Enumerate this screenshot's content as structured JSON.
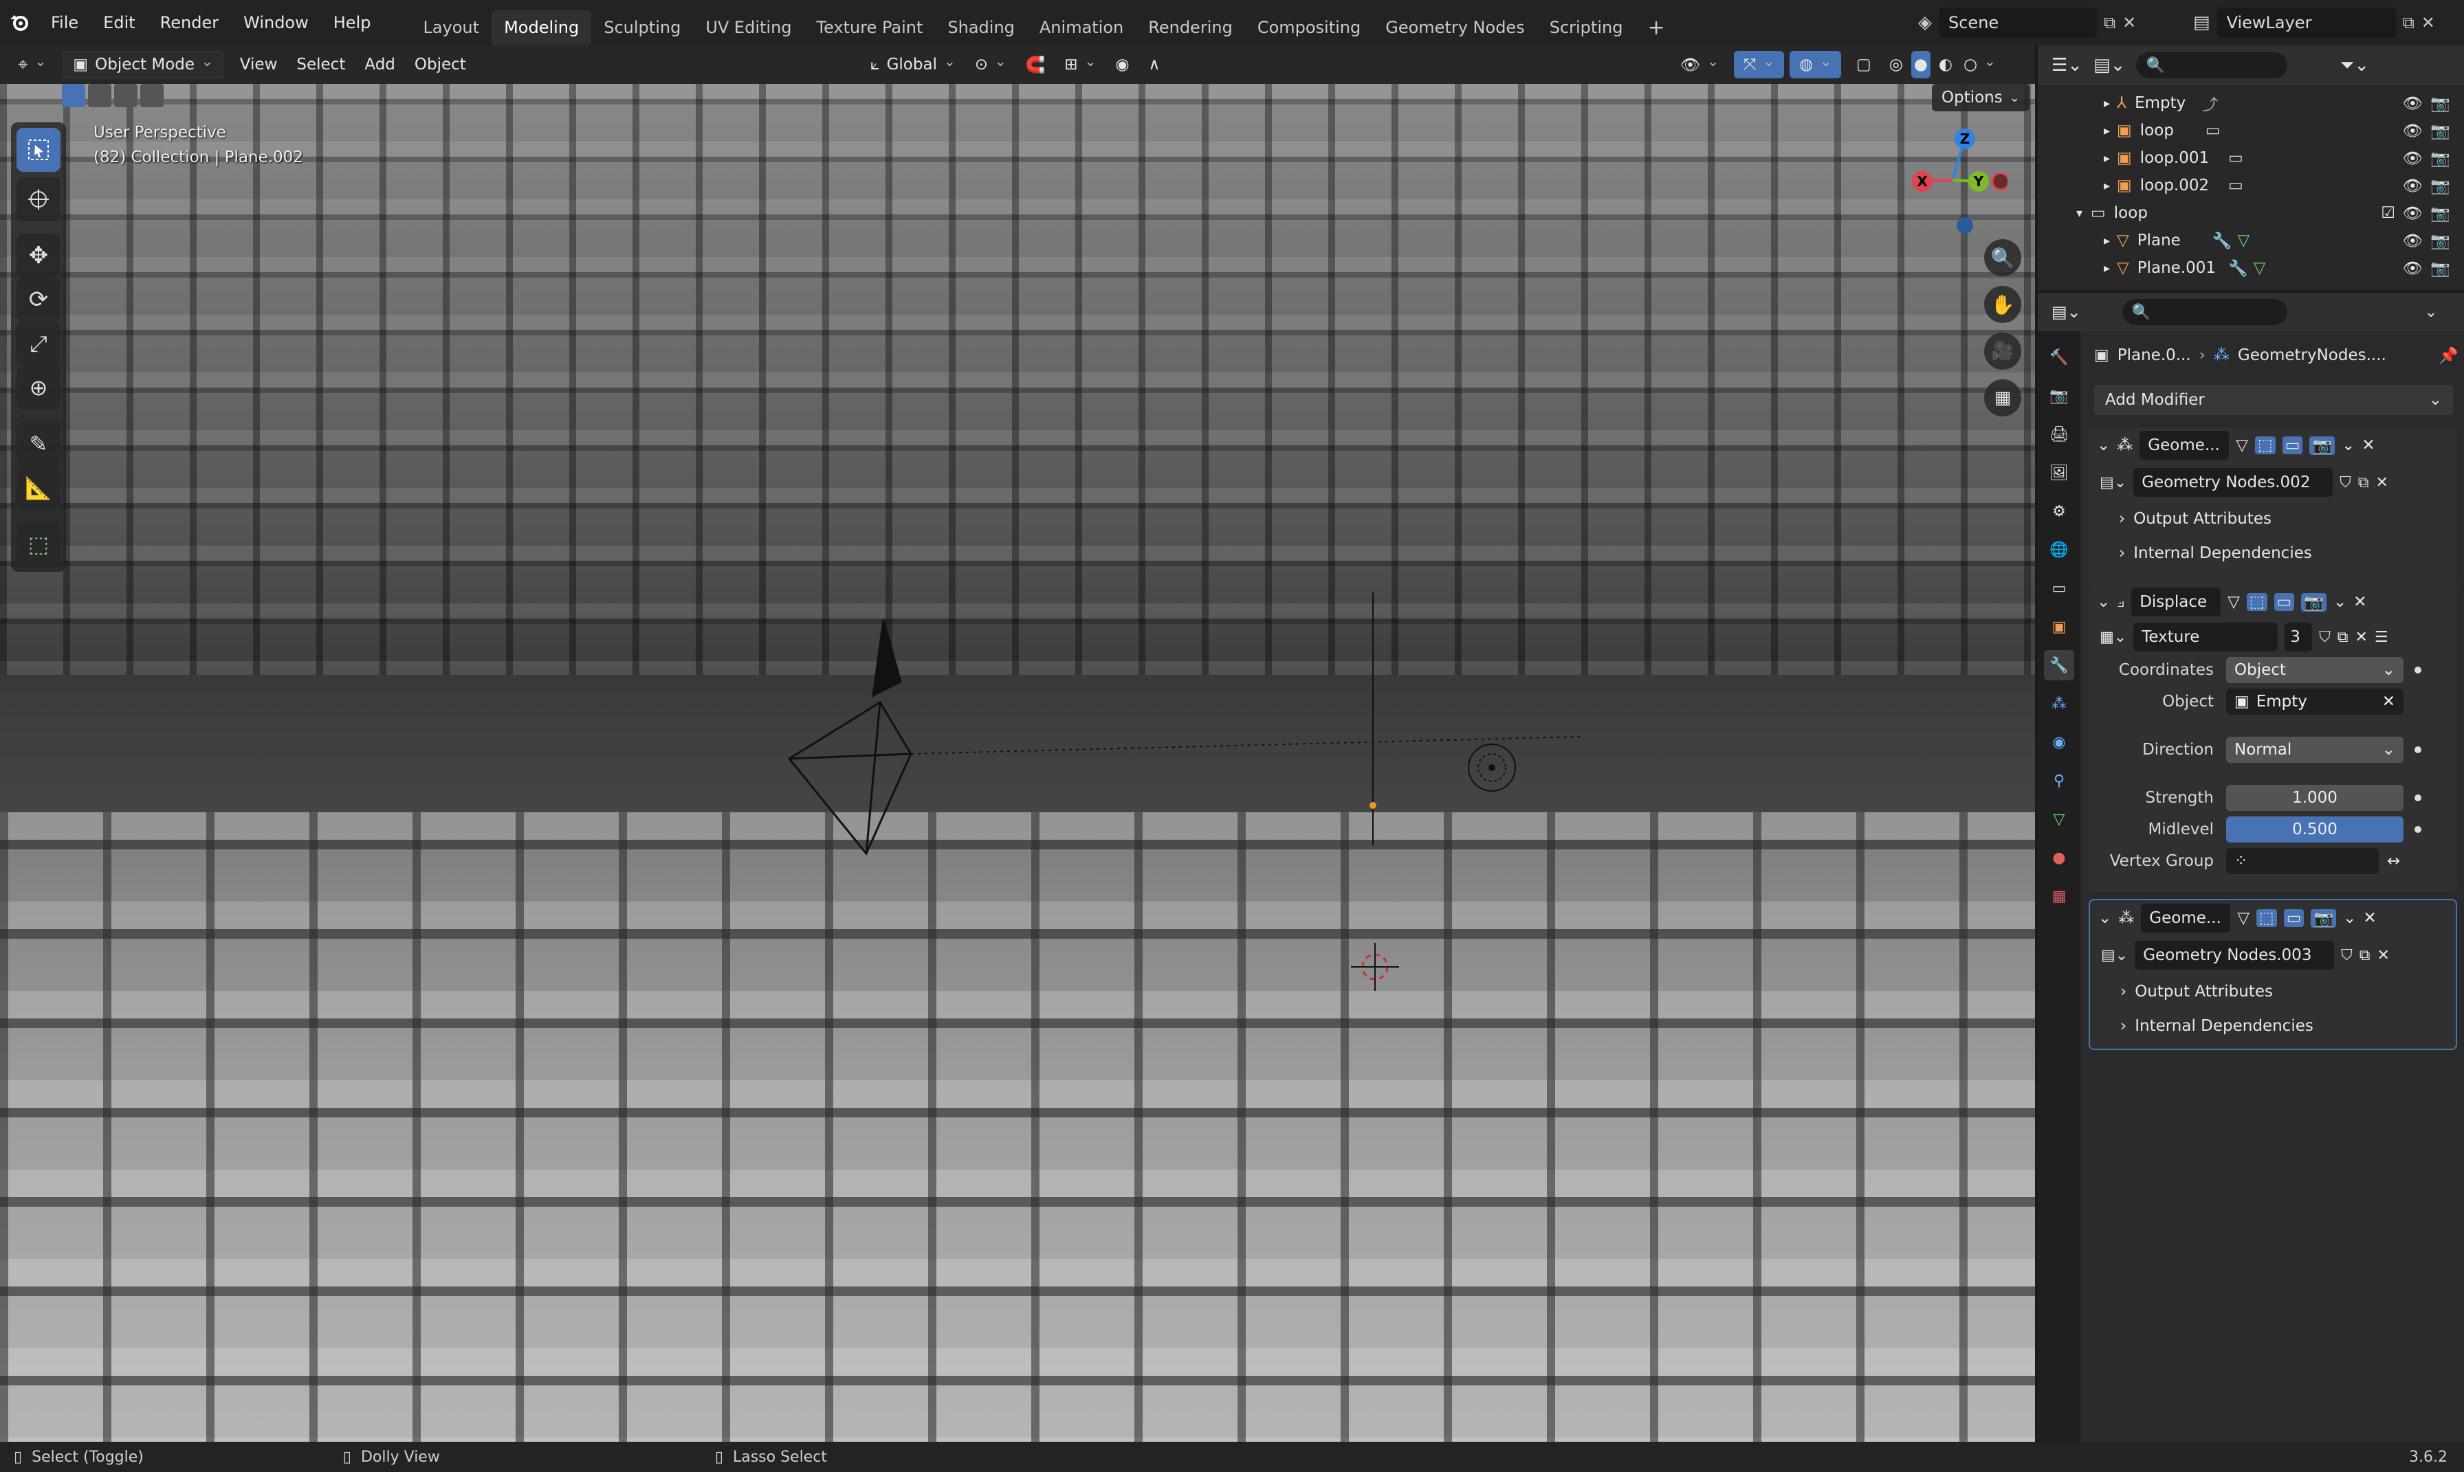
{
  "topbar": {
    "menus": [
      "File",
      "Edit",
      "Render",
      "Window",
      "Help"
    ],
    "workspaces": [
      "Layout",
      "Modeling",
      "Sculpting",
      "UV Editing",
      "Texture Paint",
      "Shading",
      "Animation",
      "Rendering",
      "Compositing",
      "Geometry Nodes",
      "Scripting"
    ],
    "active_workspace": "Modeling",
    "scene": "Scene",
    "view_layer": "ViewLayer"
  },
  "viewport_header": {
    "mode": "Object Mode",
    "menus": [
      "View",
      "Select",
      "Add",
      "Object"
    ],
    "transform_orientation": "Global",
    "options_label": "Options"
  },
  "viewport": {
    "perspective_label": "User Perspective",
    "collection_label": "(82) Collection | Plane.002",
    "gizmo_axes": {
      "z": "Z",
      "y": "Y",
      "x": "X"
    }
  },
  "outliner": {
    "rows": [
      {
        "name": "Empty",
        "type": "empty",
        "indent": 1
      },
      {
        "name": "loop",
        "type": "object",
        "indent": 1
      },
      {
        "name": "loop.001",
        "type": "object",
        "indent": 1
      },
      {
        "name": "loop.002",
        "type": "object",
        "indent": 1
      },
      {
        "name": "loop",
        "type": "collection",
        "indent": 0
      },
      {
        "name": "Plane",
        "type": "mesh",
        "indent": 1
      },
      {
        "name": "Plane.001",
        "type": "mesh",
        "indent": 1
      }
    ]
  },
  "properties": {
    "breadcrumb_object": "Plane.0...",
    "breadcrumb_modifier": "GeometryNodes....",
    "add_modifier_label": "Add Modifier",
    "modifier1": {
      "name": "Geome...",
      "node_group": "Geometry Nodes.002",
      "output_attributes": "Output Attributes",
      "internal_dependencies": "Internal Dependencies"
    },
    "modifier2": {
      "name": "Displace",
      "texture_label": "Texture",
      "texture_users": "3",
      "coordinates_label": "Coordinates",
      "coordinates_value": "Object",
      "object_label": "Object",
      "object_value": "Empty",
      "direction_label": "Direction",
      "direction_value": "Normal",
      "strength_label": "Strength",
      "strength_value": "1.000",
      "midlevel_label": "Midlevel",
      "midlevel_value": "0.500",
      "vertex_group_label": "Vertex Group"
    },
    "modifier3": {
      "name": "Geome...",
      "node_group": "Geometry Nodes.003",
      "output_attributes": "Output Attributes",
      "internal_dependencies": "Internal Dependencies"
    }
  },
  "statusbar": {
    "hint1": "Select (Toggle)",
    "hint2": "Dolly View",
    "hint3": "Lasso Select",
    "version": "3.6.2"
  },
  "colors": {
    "accent_blue": "#4772b3",
    "axis_x": "#e0424f",
    "axis_y": "#7fba28",
    "axis_z": "#2f83e3"
  }
}
